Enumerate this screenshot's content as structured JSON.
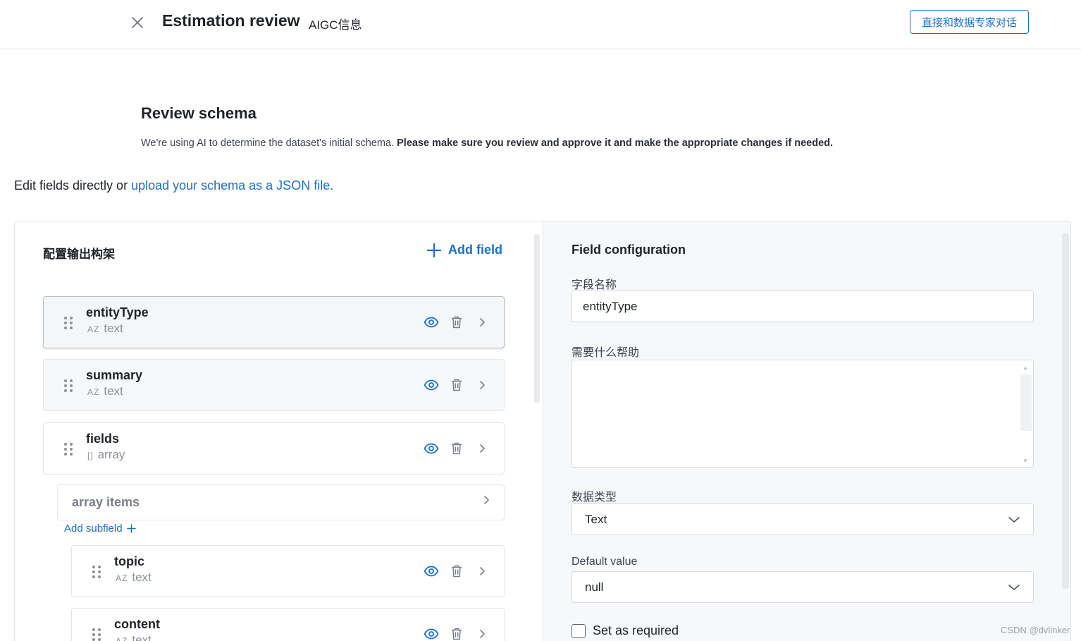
{
  "header": {
    "title": "Estimation review",
    "subtitle": "AIGC信息",
    "expert_button": "直接和数据专家对话"
  },
  "intro": {
    "title": "Review schema",
    "desc_plain": "We're using AI to determine the dataset's initial schema. ",
    "desc_bold": "Please make sure you review and approve it and make the appropriate changes if needed.",
    "edit_prefix": "Edit fields directly or ",
    "edit_link": "upload your schema as a JSON file."
  },
  "schema_panel": {
    "title": "配置输出构架",
    "add_field": "Add field",
    "fields": [
      {
        "name": "entityType",
        "type_glyph": "AZ",
        "type": "text"
      },
      {
        "name": "summary",
        "type_glyph": "AZ",
        "type": "text"
      },
      {
        "name": "fields",
        "type_glyph": "[]",
        "type": "array"
      }
    ],
    "array_items_label": "array items",
    "add_subfield": "Add subfield",
    "subfields": [
      {
        "name": "topic",
        "type_glyph": "AZ",
        "type": "text"
      },
      {
        "name": "content",
        "type_glyph": "AZ",
        "type": "text"
      }
    ]
  },
  "config_panel": {
    "title": "Field configuration",
    "field_name_label": "字段名称",
    "field_name_value": "entityType",
    "help_label": "需要什么帮助",
    "help_value": "",
    "data_type_label": "数据类型",
    "data_type_value": "Text",
    "default_label": "Default value",
    "default_value": "null",
    "required_label": "Set as required"
  },
  "watermark": "CSDN @dvlinker",
  "colors": {
    "accent": "#1a6fc9",
    "border": "#e3e5e8",
    "panel_bg": "#f7f8fa"
  }
}
